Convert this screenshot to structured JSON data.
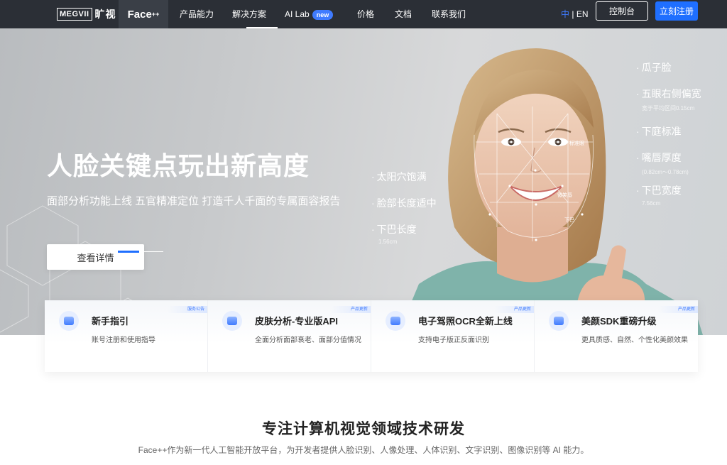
{
  "nav": {
    "logo_box": "MEGVII",
    "logo_cn": "旷视",
    "product": "Face",
    "product_sup": "++",
    "items": [
      {
        "label": "产品能力"
      },
      {
        "label": "解决方案"
      },
      {
        "label": "AI Lab"
      },
      {
        "label": "价格"
      },
      {
        "label": "文档"
      },
      {
        "label": "联系我们"
      }
    ],
    "new_badge": "new",
    "lang_cn": "中",
    "lang_sep": " | ",
    "lang_en": "EN",
    "console": "控制台",
    "register": "立刻注册"
  },
  "hero": {
    "title": "人脸关键点玩出新高度",
    "subtitle": "面部分析功能上线  五官精准定位  打造千人千面的专属面容报告",
    "button": "查看详情",
    "labels_left": [
      {
        "text": "太阳穴饱满"
      },
      {
        "text": "脸部长度适中"
      },
      {
        "text": "下巴长度",
        "sub": "1.56cm"
      }
    ],
    "labels_right": [
      {
        "text": "瓜子脸"
      },
      {
        "text": "五眼右侧偏宽",
        "sub": "宽于平均区间0.15cm"
      },
      {
        "text": "下庭标准"
      },
      {
        "text": "嘴唇厚度",
        "sub": "(0.82cm～0.78cm)"
      },
      {
        "text": "下巴宽度",
        "sub": "7.56cm"
      }
    ],
    "face_tags": [
      "标准眼",
      "微笑唇",
      "下巴"
    ]
  },
  "cards": [
    {
      "tag": "服务公告",
      "title": "新手指引",
      "desc": "账号注册和使用指导"
    },
    {
      "tag": "产品更新",
      "title": "皮肤分析-专业版API",
      "desc": "全面分析面部衰老、面部分值情况"
    },
    {
      "tag": "产品更新",
      "title": "电子驾照OCR全新上线",
      "desc": "支持电子版正反面识别"
    },
    {
      "tag": "产品更新",
      "title": "美颜SDK重磅升级",
      "desc": "更具质感、自然、个性化美颜效果"
    }
  ],
  "section": {
    "title": "专注计算机视觉领域技术研发",
    "desc": "Face++作为新一代人工智能开放平台，为开发者提供人脸识别、人像处理、人体识别、文字识别、图像识别等 AI 能力。"
  },
  "colors": {
    "nav_bg": "#2b2f36",
    "accent": "#1f6fff",
    "badge": "#3f7bff"
  }
}
